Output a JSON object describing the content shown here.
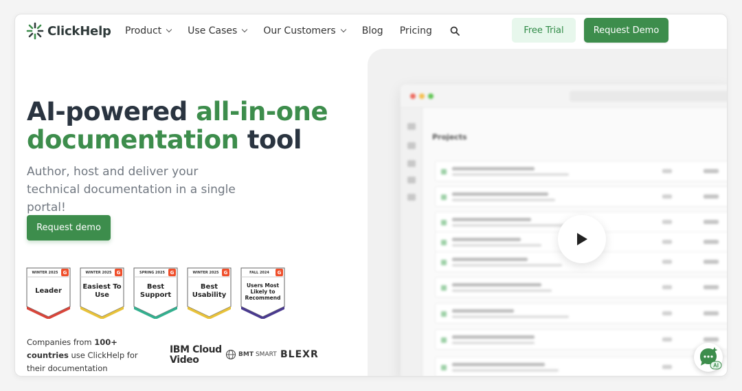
{
  "header": {
    "logo_text": "ClickHelp",
    "nav": [
      {
        "label": "Product",
        "dropdown": true
      },
      {
        "label": "Use Cases",
        "dropdown": true
      },
      {
        "label": "Our Customers",
        "dropdown": true
      },
      {
        "label": "Blog",
        "dropdown": false
      },
      {
        "label": "Pricing",
        "dropdown": false
      }
    ],
    "free_trial_label": "Free Trial",
    "request_demo_label": "Request Demo"
  },
  "hero": {
    "title_part1": "AI-powered ",
    "title_highlight1": "all-in-one",
    "title_highlight2": "documentation",
    "title_part2": " tool",
    "subtitle": "Author, host and deliver your technical documentation in a single portal!",
    "cta_label": "Request demo"
  },
  "badges": [
    {
      "season": "WINTER 2025",
      "title": "Leader",
      "color": "#d9453a",
      "small": false
    },
    {
      "season": "WINTER 2025",
      "title": "Easiest To Use",
      "color": "#e8c23a",
      "small": false
    },
    {
      "season": "SPRING 2025",
      "title": "Best Support",
      "color": "#33b08f",
      "small": false
    },
    {
      "season": "WINTER 2025",
      "title": "Best Usability",
      "color": "#e8c23a",
      "small": false
    },
    {
      "season": "FALL 2024",
      "title": "Users Most Likely to Recommend",
      "color": "#4a3a8f",
      "small": true
    }
  ],
  "badge_brand": "G",
  "customers": {
    "text_prefix": "Companies from ",
    "text_bold": "100+ countries",
    "text_suffix": " use ClickHelp for their documentation management",
    "logos": {
      "ibm_line1": "IBM Cloud",
      "ibm_line2": "Video",
      "bmt_bold": "BMT",
      "bmt_rest": "SMART",
      "blexr": "BLEXR"
    }
  },
  "preview": {
    "window_title": "Projects"
  },
  "ai_badge": "AI",
  "colors": {
    "brand_green": "#3d8d4c",
    "trial_bg": "#e7f7ec",
    "heading": "#2a3440"
  }
}
